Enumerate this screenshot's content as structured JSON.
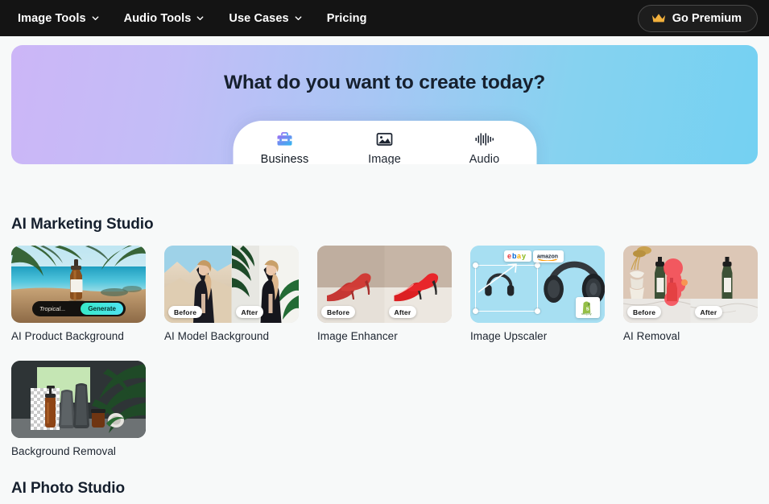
{
  "nav": {
    "items": [
      {
        "label": "Image Tools",
        "has_dropdown": true,
        "icon": "chevron-down-icon"
      },
      {
        "label": "Audio Tools",
        "has_dropdown": true,
        "icon": "chevron-down-icon"
      },
      {
        "label": "Use Cases",
        "has_dropdown": true,
        "icon": "chevron-down-icon"
      },
      {
        "label": "Pricing",
        "has_dropdown": false,
        "icon": ""
      }
    ],
    "premium": {
      "label": "Go Premium",
      "icon": "crown-icon",
      "icon_color": "#f2b03c"
    }
  },
  "hero": {
    "title": "What do you want to create today?",
    "gradient_from": "#ccb6f7",
    "gradient_to": "#74d1f2",
    "tabs": [
      {
        "label": "Business",
        "icon": "briefcase-icon",
        "active": true
      },
      {
        "label": "Image",
        "icon": "image-icon",
        "active": false
      },
      {
        "label": "Audio",
        "icon": "waveform-icon",
        "active": false
      }
    ],
    "active_tab_underline": "#9b6ef3"
  },
  "sections": [
    {
      "title": "AI Marketing Studio",
      "cards": [
        {
          "label": "AI Product Background",
          "thumb": "tropical-beach-bottle",
          "prompt_value": "Tropical...",
          "generate_label": "Generate"
        },
        {
          "label": "AI Model Background",
          "thumb": "model-before-after",
          "before_label": "Before",
          "after_label": "After"
        },
        {
          "label": "Image Enhancer",
          "thumb": "red-heels-before-after",
          "before_label": "Before",
          "after_label": "After"
        },
        {
          "label": "Image Upscaler",
          "thumb": "headphones-upscale",
          "badges": [
            "ebay",
            "amazon",
            "shopify"
          ]
        },
        {
          "label": "AI Removal",
          "thumb": "bottle-removal",
          "before_label": "Before",
          "after_label": "After"
        },
        {
          "label": "Background Removal",
          "thumb": "cosmetics-transparent"
        }
      ]
    },
    {
      "title": "AI Photo Studio",
      "cards": []
    }
  ]
}
